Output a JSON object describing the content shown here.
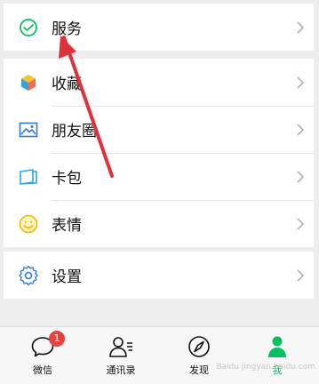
{
  "menu": {
    "service": {
      "label": "服务",
      "icon": "service-icon"
    },
    "items": [
      {
        "label": "收藏",
        "icon": "favorites-icon"
      },
      {
        "label": "朋友圈",
        "icon": "moments-icon"
      },
      {
        "label": "卡包",
        "icon": "card-pack-icon"
      },
      {
        "label": "表情",
        "icon": "sticker-icon"
      }
    ],
    "settings": {
      "label": "设置",
      "icon": "settings-icon"
    }
  },
  "tabbar": {
    "tabs": [
      {
        "label": "微信",
        "icon": "chat-icon",
        "badge": "1"
      },
      {
        "label": "通讯录",
        "icon": "contacts-icon"
      },
      {
        "label": "发现",
        "icon": "discover-icon"
      },
      {
        "label": "我",
        "icon": "me-icon",
        "active": true
      }
    ]
  },
  "watermark": "Baidu jingyan.baidu.com",
  "colors": {
    "accent_green": "#07c160",
    "arrow_red": "#e0303a",
    "badge_red": "#e64340"
  }
}
